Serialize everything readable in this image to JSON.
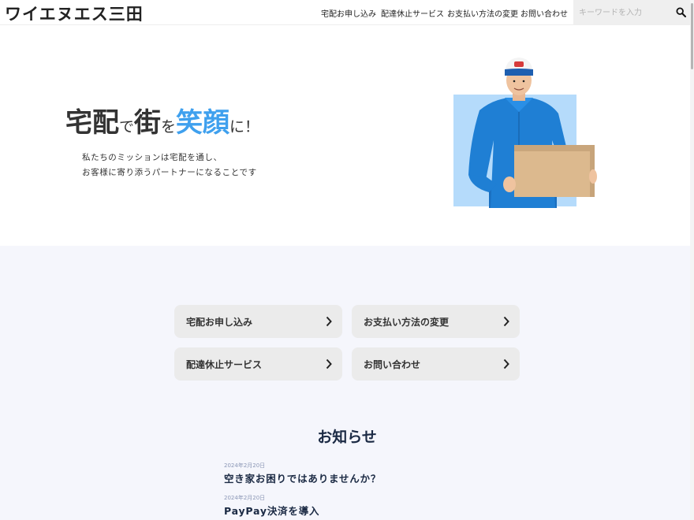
{
  "header": {
    "logo": "ワイエヌエス三田",
    "nav": [
      "宅配お申し込み",
      "配達休止サービス",
      "お支払い方法の変更",
      "お問い合わせ"
    ],
    "search_placeholder": "キーワードを入力",
    "search_icon": "search-icon"
  },
  "hero": {
    "title": {
      "part1": "宅配",
      "part2": "で",
      "part3": "街",
      "part4": "を",
      "part5": "笑顔",
      "part6": "に！"
    },
    "description": [
      "私たちのミッションは宅配を通し、",
      "お客様に寄り添うパートナーになることです"
    ],
    "accent_color": "#3fa0ee",
    "image_bg_color": "#b5dbfb"
  },
  "services": [
    {
      "label": "宅配お申し込み",
      "icon": "chevron-right-icon"
    },
    {
      "label": "お支払い方法の変更",
      "icon": "chevron-right-icon"
    },
    {
      "label": "配達休止サービス",
      "icon": "chevron-right-icon"
    },
    {
      "label": "お問い合わせ",
      "icon": "chevron-right-icon"
    }
  ],
  "news": {
    "title": "お知らせ",
    "items": [
      {
        "date": "2024年2月20日",
        "title": "空き家お困りではありませんか？"
      },
      {
        "date": "2024年2月20日",
        "title": "PayPay決済を導入"
      }
    ]
  }
}
